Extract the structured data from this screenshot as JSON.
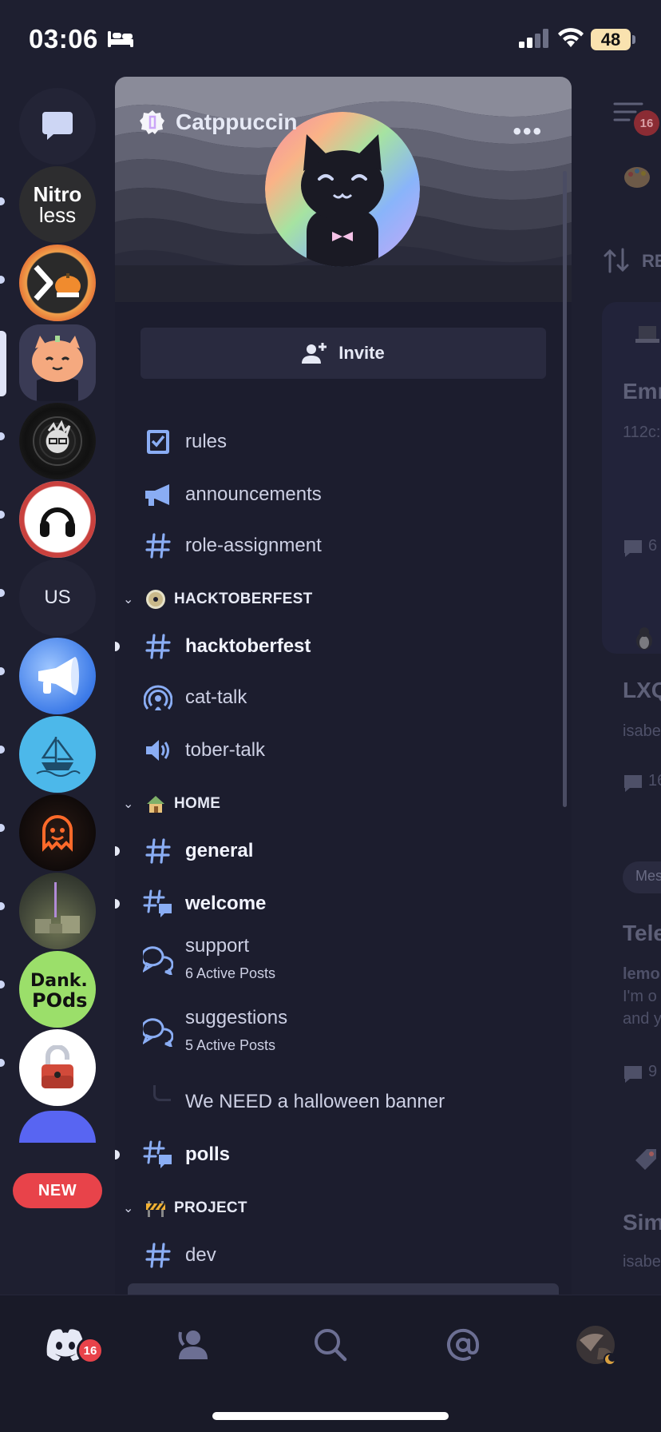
{
  "status_bar": {
    "time": "03:06",
    "battery": "48"
  },
  "rail": {
    "servers": [
      {
        "name": "direct-messages",
        "label": ""
      },
      {
        "name": "nitroless",
        "label_line1": "Nitro",
        "label_line2": "less"
      },
      {
        "name": "plex-halloween",
        "label": ""
      },
      {
        "name": "catppuccin",
        "label": ""
      },
      {
        "name": "record-server",
        "label": ""
      },
      {
        "name": "headphones-server",
        "label": ""
      },
      {
        "name": "us-server",
        "label": "US"
      },
      {
        "name": "megaphone-server",
        "label": ""
      },
      {
        "name": "ship-server",
        "label": ""
      },
      {
        "name": "ghost-server",
        "label": ""
      },
      {
        "name": "castle-server",
        "label": ""
      },
      {
        "name": "dank-pods",
        "label": ""
      },
      {
        "name": "lock-server",
        "label": ""
      }
    ],
    "new_badge": "NEW"
  },
  "server": {
    "name": "Catppuccin",
    "more": "•••",
    "invite_label": "Invite"
  },
  "channels": {
    "rules": "rules",
    "announcements": "announcements",
    "role_assignment": "role-assignment",
    "cat_hacktoberfest": "HACKTOBERFEST",
    "hacktoberfest": "hacktoberfest",
    "cat_talk": "cat-talk",
    "tober_talk": "tober-talk",
    "cat_home": "HOME",
    "general": "general",
    "welcome": "welcome",
    "support": "support",
    "support_sub": "6 Active Posts",
    "suggestions": "suggestions",
    "suggestions_sub": "5 Active Posts",
    "thread_halloween": "We NEED a halloween banner",
    "polls": "polls",
    "cat_project": "PROJECT",
    "dev": "dev"
  },
  "peek": {
    "badge": "16",
    "re": "RE",
    "emr": "Emr",
    "sub1": "112c:",
    "count1": "6",
    "lxq": "LXQ",
    "isabe1": "isabe",
    "count2": "16",
    "mes": "Mes",
    "tele": "Tele",
    "lemo": "lemo",
    "im_o": "I'm o",
    "and_y": "and y",
    "count3": "9",
    "sim": "Sim",
    "isabe2": "isabe"
  },
  "nav": {
    "badge": "16"
  },
  "colors": {
    "accent": "#8aadf4",
    "badge": "#e8434a",
    "battery": "#f9e2af"
  }
}
